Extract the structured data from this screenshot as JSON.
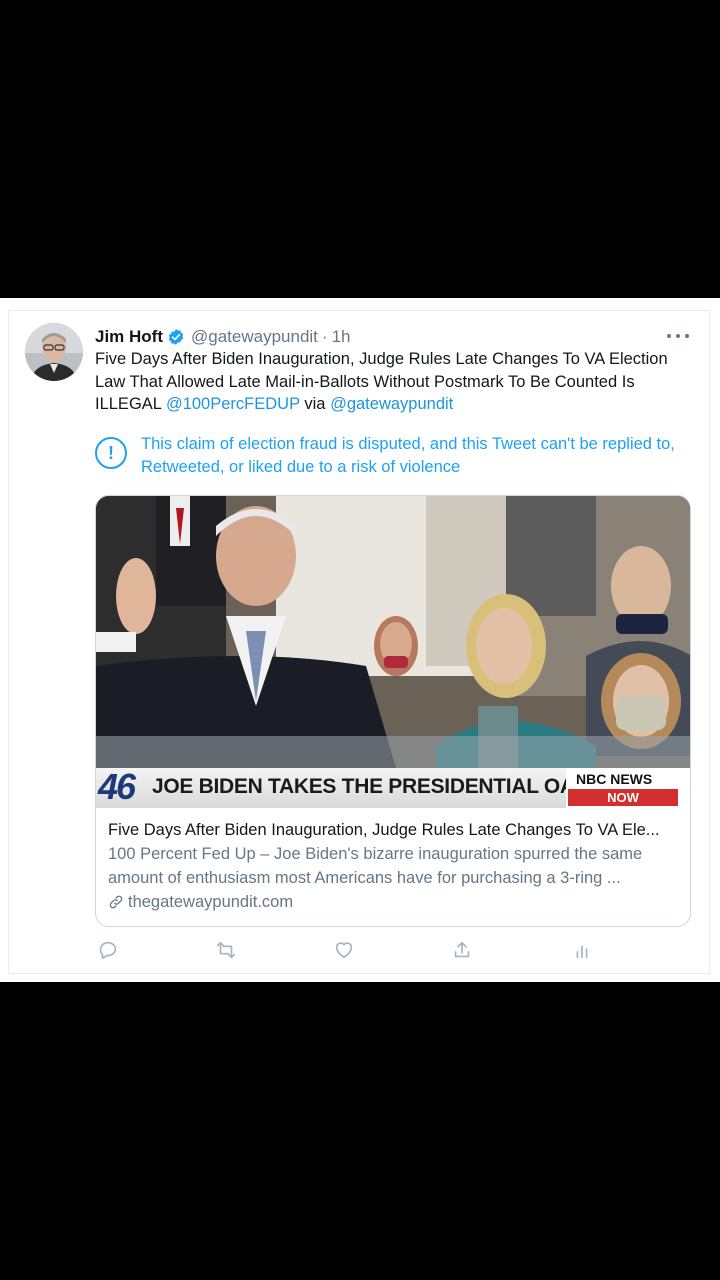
{
  "tweet": {
    "author_name": "Jim Hoft",
    "handle": "@gatewaypundit",
    "separator": "·",
    "time": "1h",
    "text_plain": "Five Days After Biden Inauguration, Judge Rules Late Changes To VA Election Law That Allowed Late Mail-in-Ballots Without Postmark To Be Counted Is ILLEGAL",
    "mention_1": "@100PercFEDUP",
    "via": "via",
    "mention_2": "@gatewaypundit"
  },
  "notice": {
    "icon": "!",
    "text": "This claim of election fraud is disputed, and this Tweet can't be replied to, Retweeted, or liked due to a risk of violence"
  },
  "card": {
    "banner_number": "46",
    "banner_text": "JOE BIDEN TAKES THE PRESIDENTIAL OATH",
    "logo_top": "NBC NEWS",
    "logo_bottom": "NOW",
    "title": "Five Days After Biden Inauguration, Judge Rules Late Changes To VA Ele...",
    "description": "100 Percent Fed Up – Joe Biden's bizarre inauguration spurred the same amount of enthusiasm most Americans have for purchasing a 3-ring ...",
    "domain": "thegatewaypundit.com"
  },
  "colors": {
    "link": "#1b95e0",
    "notice": "#1da1f2",
    "secondary_text": "#657786"
  },
  "icons": [
    "verified-badge-icon",
    "more-icon",
    "info-exclamation-icon",
    "link-icon",
    "reply-icon",
    "retweet-icon",
    "like-icon",
    "share-icon",
    "analytics-icon"
  ]
}
